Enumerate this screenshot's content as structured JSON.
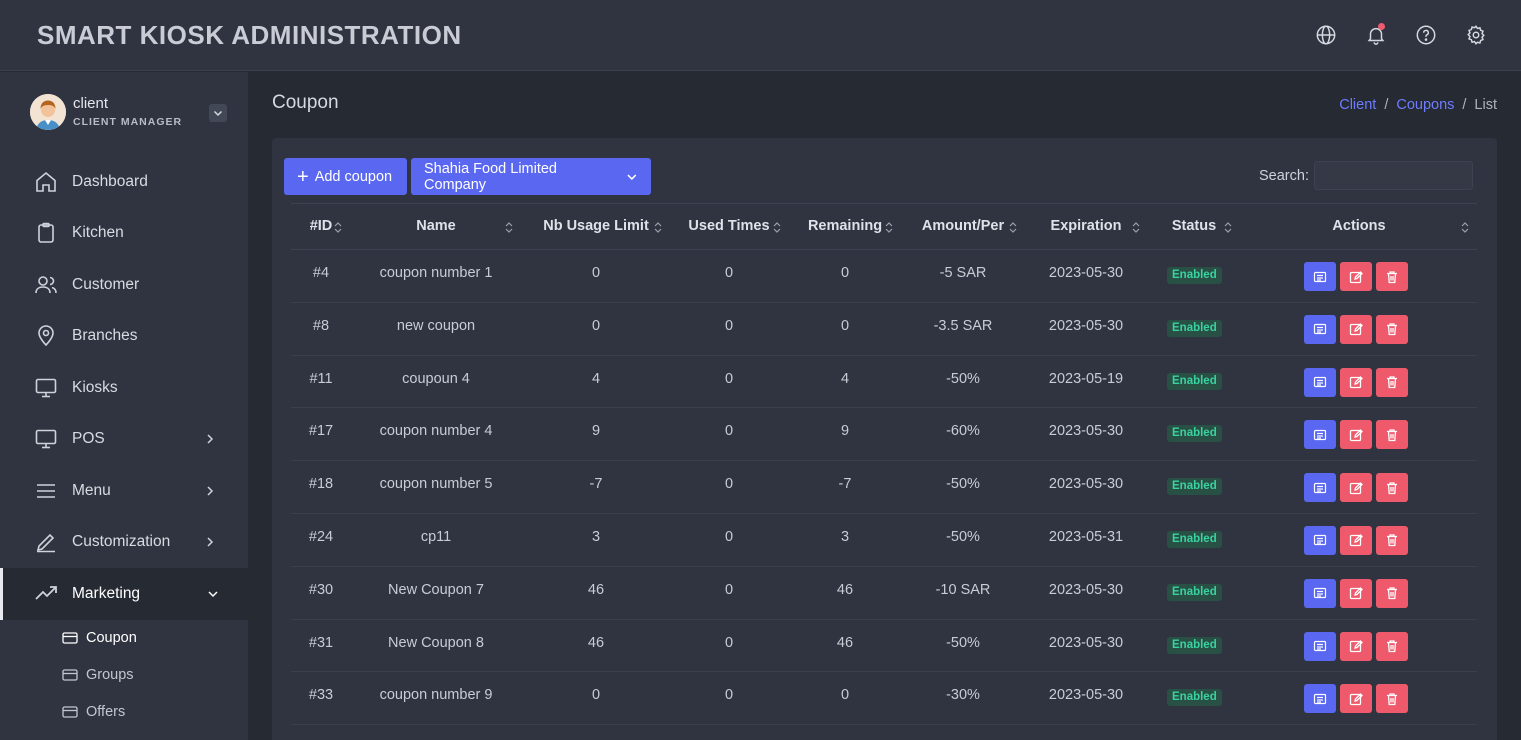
{
  "app": {
    "title": "SMART KIOSK ADMINISTRATION"
  },
  "header_icons": [
    "globe-icon",
    "bell-icon",
    "help-icon",
    "gear-icon"
  ],
  "user": {
    "name": "client",
    "role": "CLIENT MANAGER"
  },
  "sidebar": {
    "items": [
      {
        "label": "Dashboard",
        "icon": "home-icon"
      },
      {
        "label": "Kitchen",
        "icon": "clipboard-icon"
      },
      {
        "label": "Customer",
        "icon": "users-icon"
      },
      {
        "label": "Branches",
        "icon": "map-pin-icon"
      },
      {
        "label": "Kiosks",
        "icon": "monitor-icon"
      },
      {
        "label": "POS",
        "icon": "monitor-icon"
      },
      {
        "label": "Menu",
        "icon": "menu-icon"
      },
      {
        "label": "Customization",
        "icon": "pen-icon"
      },
      {
        "label": "Marketing",
        "icon": "trending-up-icon"
      }
    ],
    "subitems": [
      {
        "label": "Coupon"
      },
      {
        "label": "Groups"
      },
      {
        "label": "Offers"
      }
    ]
  },
  "page": {
    "title": "Coupon"
  },
  "breadcrumb": {
    "items": [
      "Client",
      "Coupons",
      "List"
    ],
    "separator": "/"
  },
  "toolbar": {
    "add_label": "Add coupon",
    "company_label": "Shahia Food Limited Company",
    "search_label": "Search:",
    "search_value": ""
  },
  "table": {
    "columns": [
      "#ID",
      "Name",
      "Nb Usage Limit",
      "Used Times",
      "Remaining",
      "Amount/Per",
      "Expiration",
      "Status",
      "Actions"
    ],
    "rows": [
      {
        "id": "#4",
        "name": "coupon number 1",
        "limit": "0",
        "used": "0",
        "remaining": "0",
        "amount": "-5 SAR",
        "expiration": "2023-05-30",
        "status": "Enabled"
      },
      {
        "id": "#8",
        "name": "new coupon",
        "limit": "0",
        "used": "0",
        "remaining": "0",
        "amount": "-3.5 SAR",
        "expiration": "2023-05-30",
        "status": "Enabled"
      },
      {
        "id": "#11",
        "name": "coupoun 4",
        "limit": "4",
        "used": "0",
        "remaining": "4",
        "amount": "-50%",
        "expiration": "2023-05-19",
        "status": "Enabled"
      },
      {
        "id": "#17",
        "name": "coupon number 4",
        "limit": "9",
        "used": "0",
        "remaining": "9",
        "amount": "-60%",
        "expiration": "2023-05-30",
        "status": "Enabled"
      },
      {
        "id": "#18",
        "name": "coupon number 5",
        "limit": "-7",
        "used": "0",
        "remaining": "-7",
        "amount": "-50%",
        "expiration": "2023-05-30",
        "status": "Enabled"
      },
      {
        "id": "#24",
        "name": "cp11",
        "limit": "3",
        "used": "0",
        "remaining": "3",
        "amount": "-50%",
        "expiration": "2023-05-31",
        "status": "Enabled"
      },
      {
        "id": "#30",
        "name": "New Coupon 7",
        "limit": "46",
        "used": "0",
        "remaining": "46",
        "amount": "-10 SAR",
        "expiration": "2023-05-30",
        "status": "Enabled"
      },
      {
        "id": "#31",
        "name": "New Coupon 8",
        "limit": "46",
        "used": "0",
        "remaining": "46",
        "amount": "-50%",
        "expiration": "2023-05-30",
        "status": "Enabled"
      },
      {
        "id": "#33",
        "name": "coupon number 9",
        "limit": "0",
        "used": "0",
        "remaining": "0",
        "amount": "-30%",
        "expiration": "2023-05-30",
        "status": "Enabled"
      }
    ]
  },
  "colors": {
    "accent": "#5a67f0",
    "danger": "#ee5a6c",
    "success": "#3ad29f",
    "background": "#262a33",
    "panel": "#2f3440"
  }
}
